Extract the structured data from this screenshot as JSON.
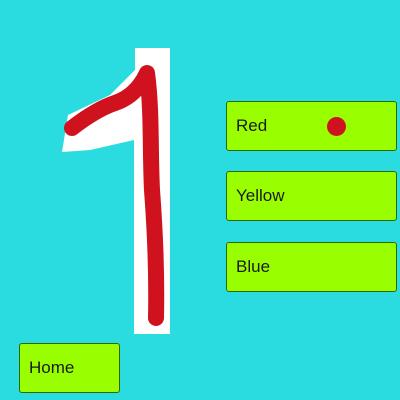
{
  "colors": {
    "background": "#2adcdf",
    "button_fill": "#99ff00",
    "digit_stroke": "#d0121e",
    "digit_shadow": "#ffffff",
    "selected_dot": "#d0121e"
  },
  "digit": {
    "icon": "number-one-drawing"
  },
  "color_options": [
    {
      "label": "Red",
      "selected": true
    },
    {
      "label": "Yellow",
      "selected": false
    },
    {
      "label": "Blue",
      "selected": false
    }
  ],
  "home_button": {
    "label": "Home"
  }
}
